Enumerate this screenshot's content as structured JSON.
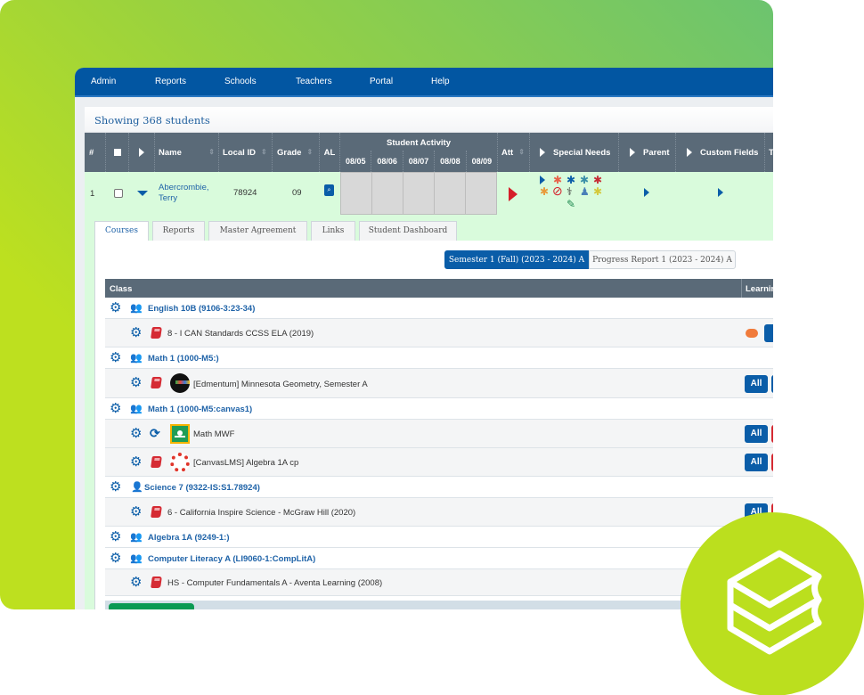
{
  "nav": {
    "items": [
      {
        "label": "Admin"
      },
      {
        "label": "Reports"
      },
      {
        "label": "Schools"
      },
      {
        "label": "Teachers"
      },
      {
        "label": "Portal"
      },
      {
        "label": "Help"
      }
    ]
  },
  "panel": {
    "title": "Showing 368 students"
  },
  "student_table": {
    "headers": {
      "number": "#",
      "name": "Name",
      "local_id": "Local ID",
      "grade": "Grade",
      "al": "AL",
      "student_activity": "Student Activity",
      "activity_dates": [
        "08/05",
        "08/06",
        "08/07",
        "08/08",
        "08/09"
      ],
      "att": "Att",
      "special_needs": "Special Needs",
      "parent": "Parent",
      "custom_fields": "Custom Fields",
      "truncated": "T"
    },
    "rows": [
      {
        "number": "1",
        "name": "Abercrombie, Terry",
        "local_id": "78924",
        "grade": "09"
      }
    ]
  },
  "detail": {
    "tabs": [
      {
        "label": "Courses",
        "active": true
      },
      {
        "label": "Reports",
        "active": false
      },
      {
        "label": "Master Agreement",
        "active": false
      },
      {
        "label": "Links",
        "active": false
      },
      {
        "label": "Student Dashboard",
        "active": false
      }
    ],
    "terms": {
      "active": "Semester 1 (Fall) (2023 - 2024) A",
      "inactive": "Progress Report 1 (2023 - 2024) A"
    },
    "class_table": {
      "headers": {
        "class": "Class",
        "learning": "Learning"
      },
      "all_label": "All",
      "groups": [
        {
          "title": "English 10B (9106-3:23-34)",
          "icon": "users-icon",
          "items": [
            {
              "title": "8 - I CAN Standards CCSS ELA (2019)",
              "icon": "book-icon"
            }
          ]
        },
        {
          "title": "Math 1 (1000-M5:)",
          "icon": "users-icon",
          "items": [
            {
              "title": "[Edmentum] Minnesota Geometry, Semester A",
              "icon": "book-icon",
              "logo": "edmentum-logo"
            }
          ]
        },
        {
          "title": "Math 1 (1000-M5:canvas1)",
          "icon": "users-icon",
          "items": [
            {
              "title": "Math MWF",
              "icon": "sync-icon",
              "logo": "google-classroom-logo"
            },
            {
              "title": "[CanvasLMS] Algebra 1A cp",
              "icon": "book-icon",
              "logo": "canvas-logo"
            }
          ]
        },
        {
          "title": "Science 7 (9322-IS:S1.78924)",
          "icon": "user-icon",
          "items": [
            {
              "title": "6 - California Inspire Science - McGraw Hill (2020)",
              "icon": "book-icon"
            }
          ]
        },
        {
          "title": "Algebra 1A (9249-1:)",
          "icon": "users-icon",
          "items": []
        },
        {
          "title": "Computer Literacy A (LI9060-1:CompLitA)",
          "icon": "users-icon",
          "items": [
            {
              "title": "HS - Computer Fundamentals A - Aventa Learning (2008)",
              "icon": "book-icon"
            }
          ]
        }
      ]
    }
  },
  "colors": {
    "nav_blue": "#0256a2",
    "header_slate": "#5a6a78",
    "row_green": "#d9fbdc",
    "link_blue": "#1f63a8",
    "badge_lime": "#bbdf1e",
    "alert_red": "#d51f2a"
  }
}
